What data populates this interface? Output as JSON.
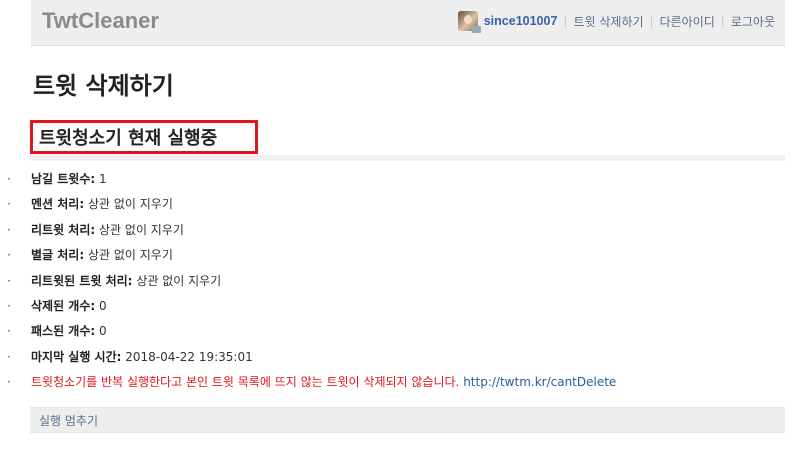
{
  "header": {
    "logo": "TwtCleaner",
    "username": "since101007",
    "nav_delete": "트윗 삭제하기",
    "nav_switch": "다른아이디",
    "nav_logout": "로그아웃",
    "separator": "|"
  },
  "page_title": "트윗 삭제하기",
  "status_label": "트윗청소기 현재 실행중",
  "info": {
    "keep": {
      "label": "남길 트윗수:",
      "value": "1"
    },
    "mention": {
      "label": "멘션 처리:",
      "value": "상관 없이 지우기"
    },
    "retweet": {
      "label": "리트윗 처리:",
      "value": "상관 없이 지우기"
    },
    "favorite": {
      "label": "별글 처리:",
      "value": "상관 없이 지우기"
    },
    "retweeted": {
      "label": "리트윗된 트윗 처리:",
      "value": "상관 없이 지우기"
    },
    "deleted": {
      "label": "삭제된 개수:",
      "value": "0"
    },
    "passed": {
      "label": "패스된 개수:",
      "value": "0"
    },
    "last_run": {
      "label": "마지막 실행 시간:",
      "value": "2018-04-22 19:35:01"
    },
    "warning_text": "트윗청소기를 반복 실행한다고 본인 트윗 목록에 뜨지 않는 트윗이 삭제되지 않습니다.",
    "warning_link": "http://twtm.kr/cantDelete"
  },
  "bullet": "·",
  "stop_label": "실행 멈추기",
  "colors": {
    "status_border": "#e3151a",
    "link": "#2b5c9b",
    "warning": "#e3151a"
  }
}
